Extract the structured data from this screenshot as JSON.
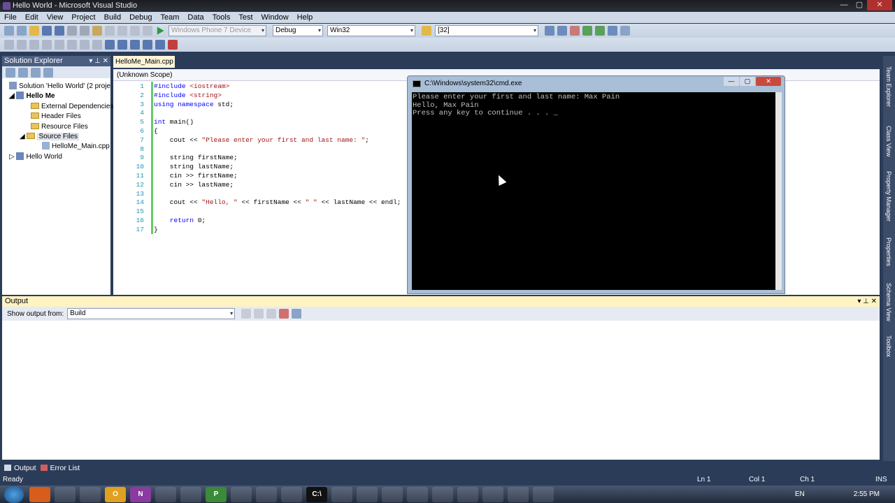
{
  "window": {
    "title": "Hello World - Microsoft Visual Studio",
    "min": "—",
    "max": "▢",
    "close": "✕"
  },
  "menu": [
    "File",
    "Edit",
    "View",
    "Project",
    "Build",
    "Debug",
    "Team",
    "Data",
    "Tools",
    "Test",
    "Window",
    "Help"
  ],
  "toolbar": {
    "device": "Windows Phone 7 Device",
    "config": "Debug",
    "platform": "Win32",
    "find": "[32]"
  },
  "solution_explorer": {
    "title": "Solution Explorer",
    "pin": "▾ ⊥ ✕",
    "items": [
      "Solution 'Hello World' (2 proje",
      "Hello Me",
      "External Dependencies",
      "Header Files",
      "Resource Files",
      "Source Files",
      "HelloMe_Main.cpp",
      "Hello World"
    ]
  },
  "editor": {
    "tab": "HelloMe_Main.cpp",
    "scope": "(Unknown Scope)",
    "line_numbers": [
      "1",
      "2",
      "3",
      "4",
      "5",
      "6",
      "7",
      "8",
      "9",
      "10",
      "11",
      "12",
      "13",
      "14",
      "15",
      "16",
      "17"
    ]
  },
  "cmd": {
    "title": "C:\\Windows\\system32\\cmd.exe",
    "output": "Please enter your first and last name: Max Pain\nHello, Max Pain\nPress any key to continue . . . _"
  },
  "output": {
    "title": "Output",
    "show_label": "Show output from:",
    "source": "Build",
    "ctl": "▾ ⊥ ✕"
  },
  "bottom_tabs": [
    "Output",
    "Error List"
  ],
  "status": {
    "ready": "Ready",
    "ln": "Ln 1",
    "col": "Col 1",
    "ch": "Ch 1",
    "ins": "INS"
  },
  "tray": {
    "lang": "EN",
    "time": "2:55 PM"
  },
  "side_tabs": [
    "Team Explorer",
    "Class View",
    "Property Manager",
    "Properties",
    "Schema View",
    "Toolbox"
  ],
  "taskbar_apps": [
    "",
    "",
    "",
    "O",
    "N",
    "",
    "",
    "P",
    "",
    "",
    "",
    "C:\\",
    "",
    "",
    "",
    "",
    "",
    "",
    "",
    "",
    ""
  ],
  "colors": {
    "accent": "#2b3c59",
    "toolbar": "#cfd9e8",
    "console": "#000000"
  }
}
